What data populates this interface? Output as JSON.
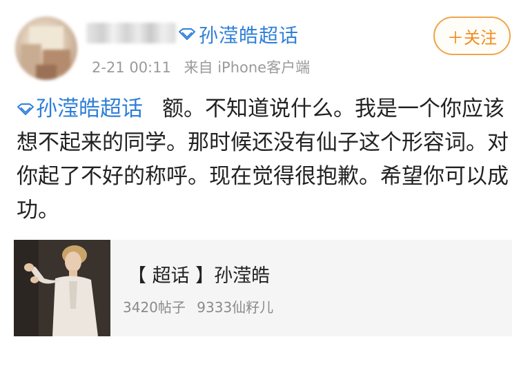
{
  "post": {
    "author": {
      "avatar": "blurred-avatar",
      "name_blurred": true
    },
    "super_topic_tag": "孙滢皓超话",
    "follow_button": "＋关注",
    "meta": {
      "time": "2-21 00:11",
      "source": "来自 iPhone客户端"
    },
    "body": {
      "topic": "孙滢皓超话",
      "text": "额。不知道说什么。我是一个你应该想不起来的同学。那时候还没有仙子这个形容词。对你起了不好的称呼。现在觉得很抱歉。希望你可以成功。"
    },
    "card": {
      "title": "【 超话 】孙滢皓",
      "posts": "3420帖子",
      "fans": "9333仙籽儿"
    }
  },
  "colors": {
    "link_blue": "#2f7fd8",
    "follow_orange": "#f08c1a",
    "meta_gray": "#9a9a9a",
    "card_bg": "#f5f5f5"
  },
  "icons": {
    "topic": "diamond-icon"
  }
}
